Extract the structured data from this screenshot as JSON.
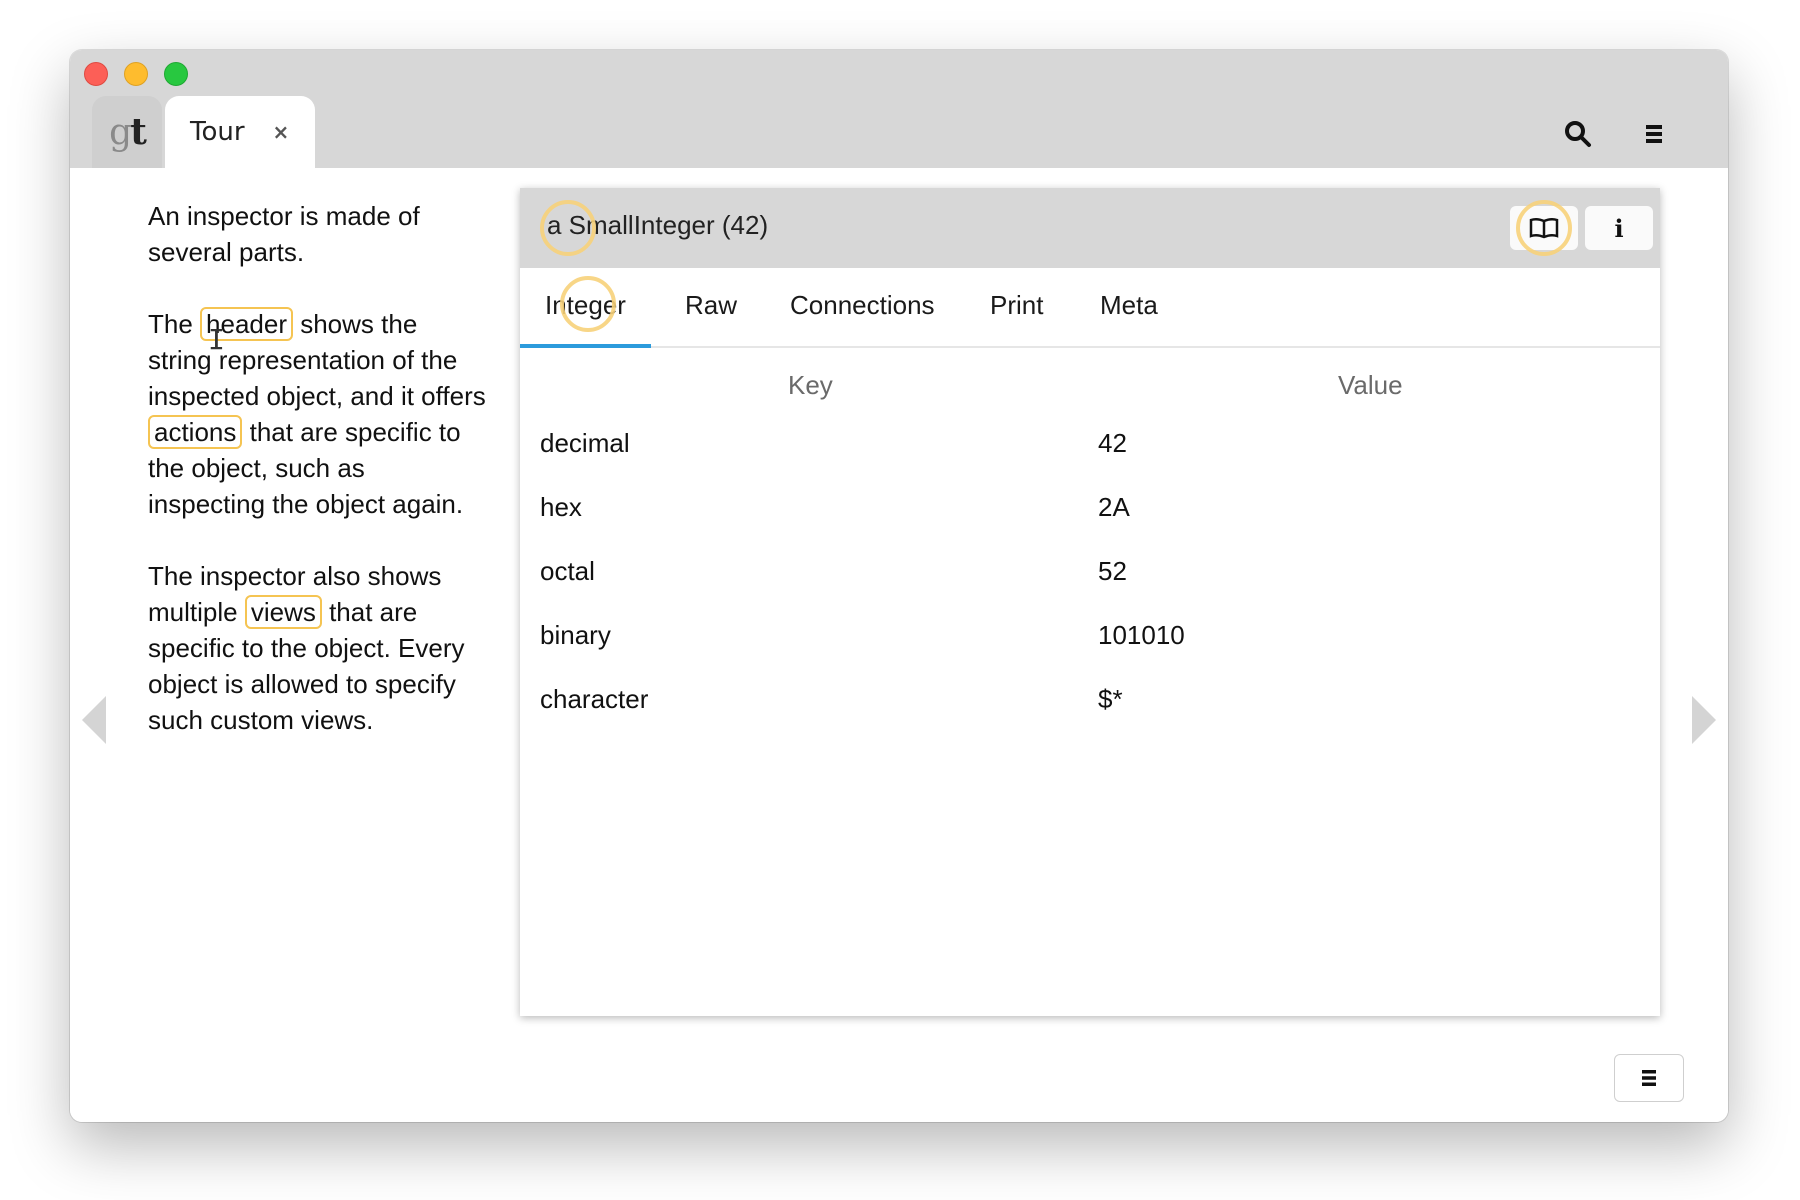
{
  "app": {
    "logo_g": "g",
    "logo_t": "t",
    "tab_label": "Tour",
    "tab_close": "×"
  },
  "toolbar": {
    "search_icon": "search-icon",
    "menu_icon": "hamburger-menu-icon"
  },
  "description": {
    "p1": "An inspector is made of several parts.",
    "p2_a": "The ",
    "p2_header": "header",
    "p2_b": " shows the string representation of the inspected object, and it offers ",
    "p2_actions": "actions",
    "p2_c": " that are specific to the object, such as inspecting the object again.",
    "p3_a": "The inspector also shows multiple ",
    "p3_views": "views",
    "p3_b": " that are specific to the object. Every object is allowed to specify such custom views."
  },
  "inspector": {
    "title": "a SmallInteger (42)",
    "book_icon": "book-icon",
    "info_label": "i",
    "tabs": [
      {
        "label": "Integer"
      },
      {
        "label": "Raw"
      },
      {
        "label": "Connections"
      },
      {
        "label": "Print"
      },
      {
        "label": "Meta"
      }
    ],
    "columns": {
      "key": "Key",
      "value": "Value"
    },
    "rows": [
      {
        "key": "decimal",
        "value": "42"
      },
      {
        "key": "hex",
        "value": "2A"
      },
      {
        "key": "octal",
        "value": "52"
      },
      {
        "key": "binary",
        "value": "101010"
      },
      {
        "key": "character",
        "value": "$*"
      }
    ]
  },
  "colors": {
    "highlight": "#f5c452",
    "active_tab": "#2c9bdc",
    "titlebar": "#d7d7d7"
  }
}
